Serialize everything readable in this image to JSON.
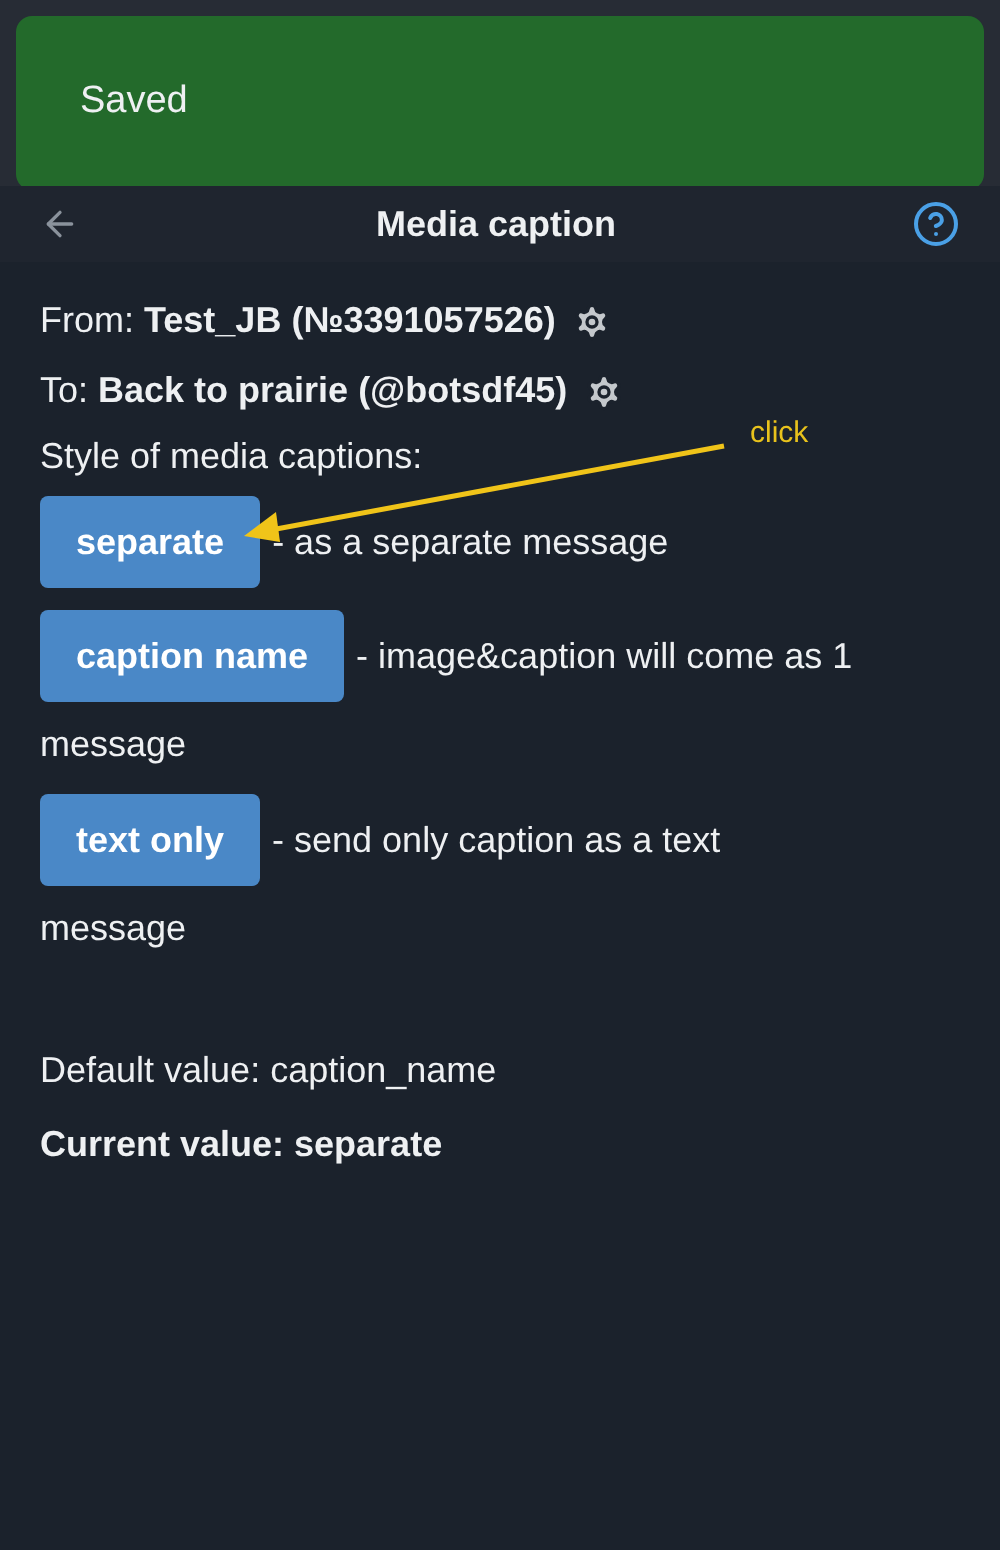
{
  "toast": {
    "text": "Saved"
  },
  "header": {
    "title": "Media caption"
  },
  "from": {
    "text": "From: **Test_JB (№3391057526)**"
  },
  "to": {
    "text": "To: **Back to prairie (@botsdf45)**"
  },
  "style_label": "Style of media captions:",
  "options": [
    {
      "label": "separate",
      "description_lines": [
        "- as a separate message"
      ]
    },
    {
      "label": "caption name",
      "description_lines": [
        "- image&caption will come as 1",
        "message"
      ]
    },
    {
      "label": "text only",
      "description_lines": [
        "- send only caption as a text",
        "message"
      ]
    }
  ],
  "default_value": "Default value: caption_name",
  "current_value": "Current value: separate",
  "annotation": {
    "text": "click"
  }
}
